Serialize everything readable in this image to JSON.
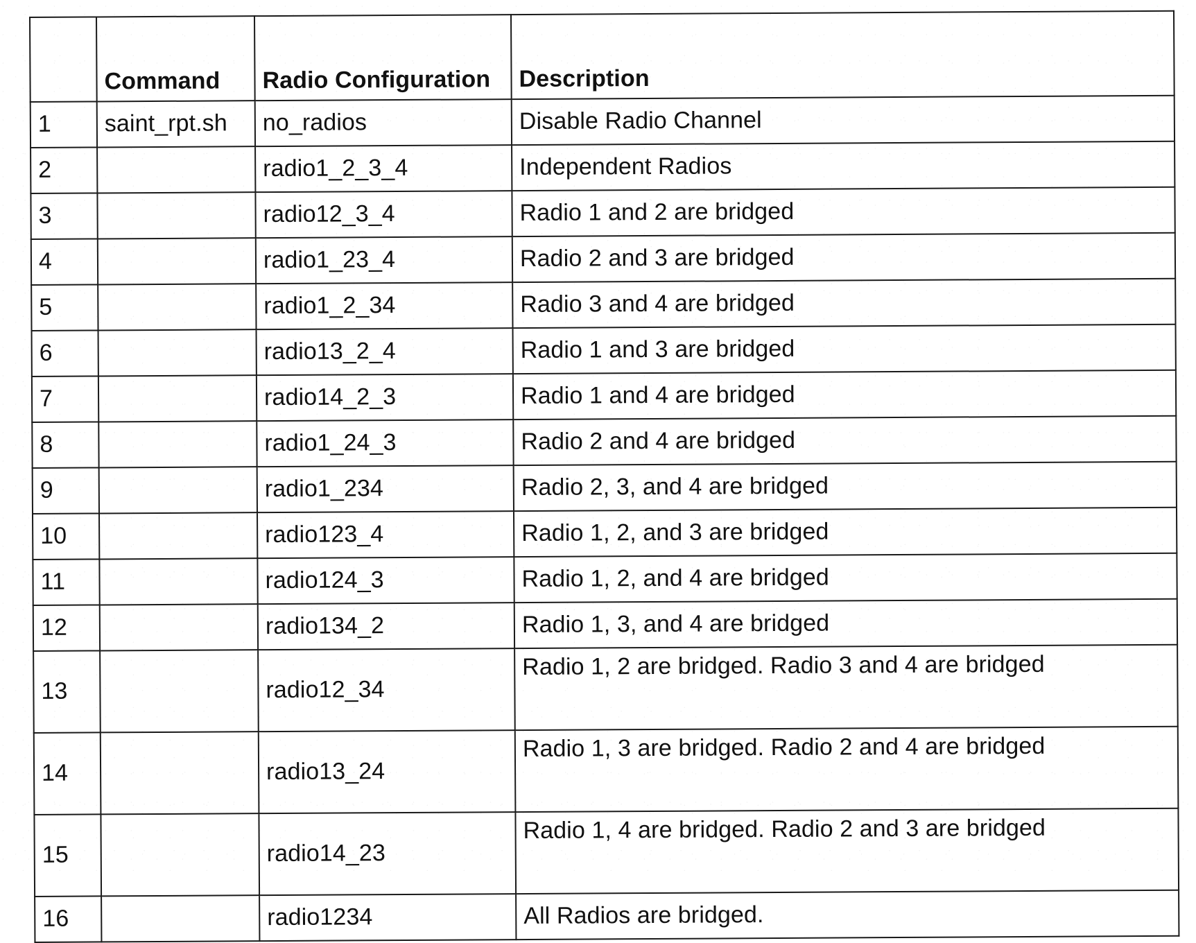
{
  "table": {
    "headers": {
      "index": "",
      "command": "Command",
      "radio_configuration": "Radio Configuration",
      "description": "Description"
    },
    "rows": [
      {
        "index": "1",
        "command": "saint_rpt.sh",
        "radio_configuration": "no_radios",
        "description": "Disable Radio Channel",
        "tall": false
      },
      {
        "index": "2",
        "command": "",
        "radio_configuration": "radio1_2_3_4",
        "description": "Independent Radios",
        "tall": false
      },
      {
        "index": "3",
        "command": "",
        "radio_configuration": "radio12_3_4",
        "description": "Radio 1 and 2 are bridged",
        "tall": false
      },
      {
        "index": "4",
        "command": "",
        "radio_configuration": "radio1_23_4",
        "description": "Radio 2 and 3 are bridged",
        "tall": false
      },
      {
        "index": "5",
        "command": "",
        "radio_configuration": "radio1_2_34",
        "description": "Radio 3 and 4 are bridged",
        "tall": false
      },
      {
        "index": "6",
        "command": "",
        "radio_configuration": "radio13_2_4",
        "description": "Radio 1 and 3 are bridged",
        "tall": false
      },
      {
        "index": "7",
        "command": "",
        "radio_configuration": "radio14_2_3",
        "description": "Radio 1 and 4 are bridged",
        "tall": false
      },
      {
        "index": "8",
        "command": "",
        "radio_configuration": "radio1_24_3",
        "description": "Radio 2 and 4 are bridged",
        "tall": false
      },
      {
        "index": "9",
        "command": "",
        "radio_configuration": "radio1_234",
        "description": "Radio 2, 3, and 4 are bridged",
        "tall": false
      },
      {
        "index": "10",
        "command": "",
        "radio_configuration": "radio123_4",
        "description": "Radio 1, 2, and 3 are bridged",
        "tall": false
      },
      {
        "index": "11",
        "command": "",
        "radio_configuration": "radio124_3",
        "description": "Radio 1, 2, and 4 are bridged",
        "tall": false
      },
      {
        "index": "12",
        "command": "",
        "radio_configuration": "radio134_2",
        "description": "Radio 1, 3, and 4 are bridged",
        "tall": false
      },
      {
        "index": "13",
        "command": "",
        "radio_configuration": "radio12_34",
        "description": "Radio 1, 2 are bridged. Radio 3 and 4 are bridged",
        "tall": true
      },
      {
        "index": "14",
        "command": "",
        "radio_configuration": "radio13_24",
        "description": "Radio 1, 3 are bridged. Radio 2 and 4 are bridged",
        "tall": true
      },
      {
        "index": "15",
        "command": "",
        "radio_configuration": "radio14_23",
        "description": "Radio 1, 4 are bridged. Radio 2 and 3 are bridged",
        "tall": true
      },
      {
        "index": "16",
        "command": "",
        "radio_configuration": "radio1234",
        "description": "All Radios are bridged.",
        "tall": false
      }
    ]
  },
  "colors": {
    "ink": "#111111",
    "rule": "#1a1a1a",
    "paper": "#ffffff"
  }
}
